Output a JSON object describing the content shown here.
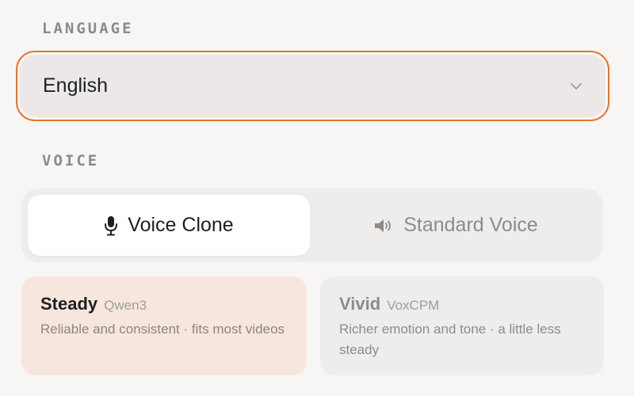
{
  "language": {
    "section_label": "LANGUAGE",
    "selected_value": "English",
    "chevron_icon": "chevron-down-icon"
  },
  "voice": {
    "section_label": "VOICE",
    "modes": [
      {
        "label": "Voice Clone",
        "icon": "microphone-icon",
        "active": true
      },
      {
        "label": "Standard Voice",
        "icon": "speaker-icon",
        "active": false
      }
    ],
    "models": [
      {
        "name": "Steady",
        "engine": "Qwen3",
        "description": "Reliable and consistent · fits most videos",
        "selected": true
      },
      {
        "name": "Vivid",
        "engine": "VoxCPM",
        "description": "Richer emotion and tone · a little less steady",
        "selected": false
      }
    ]
  },
  "colors": {
    "accent": "#e9742b",
    "selected_card_bg": "#f7e6dd",
    "page_bg": "#f7f6f4"
  }
}
